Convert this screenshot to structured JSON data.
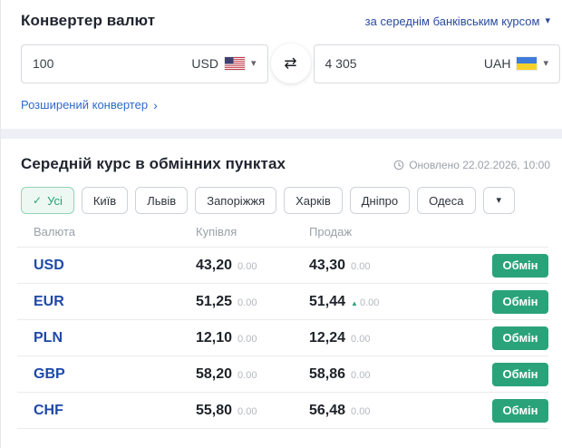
{
  "icons": {
    "caret_down": "▾",
    "swap": "⇄",
    "chevron_right": "›",
    "check": "✓",
    "up_triangle": "▲"
  },
  "converter": {
    "title": "Конвертер валют",
    "rate_type_label": "за середнім банківським курсом",
    "from": {
      "amount": "100",
      "currency": "USD",
      "flag": "us-flag"
    },
    "to": {
      "amount": "4 305",
      "currency": "UAH",
      "flag": "ua-flag"
    },
    "advanced_link": "Розширений конвертер"
  },
  "rates": {
    "title": "Середній курс в обмінних пунктах",
    "updated": "Оновлено 22.02.2026, 10:00",
    "filters": [
      "Усі",
      "Київ",
      "Львів",
      "Запоріжжя",
      "Харків",
      "Дніпро",
      "Одеса"
    ],
    "selected_filter": "Усі",
    "columns": [
      "Валюта",
      "Купівля",
      "Продаж"
    ],
    "exchange_button_label": "Обмін",
    "rows": [
      {
        "code": "USD",
        "buy": "43,20",
        "buy_delta": "0.00",
        "sell": "43,30",
        "sell_delta": "0.00",
        "sell_up": false
      },
      {
        "code": "EUR",
        "buy": "51,25",
        "buy_delta": "0.00",
        "sell": "51,44",
        "sell_delta": "0.00",
        "sell_up": true
      },
      {
        "code": "PLN",
        "buy": "12,10",
        "buy_delta": "0.00",
        "sell": "12,24",
        "sell_delta": "0.00",
        "sell_up": false
      },
      {
        "code": "GBP",
        "buy": "58,20",
        "buy_delta": "0.00",
        "sell": "58,86",
        "sell_delta": "0.00",
        "sell_up": false
      },
      {
        "code": "CHF",
        "buy": "55,80",
        "buy_delta": "0.00",
        "sell": "56,48",
        "sell_delta": "0.00",
        "sell_up": false
      }
    ]
  },
  "colors": {
    "accent_green": "#2aa37b",
    "code_blue": "#1d49a7",
    "link_blue": "#2f6ace",
    "navy_link": "#2a4b9e",
    "muted_gray": "#9ba1a8"
  }
}
